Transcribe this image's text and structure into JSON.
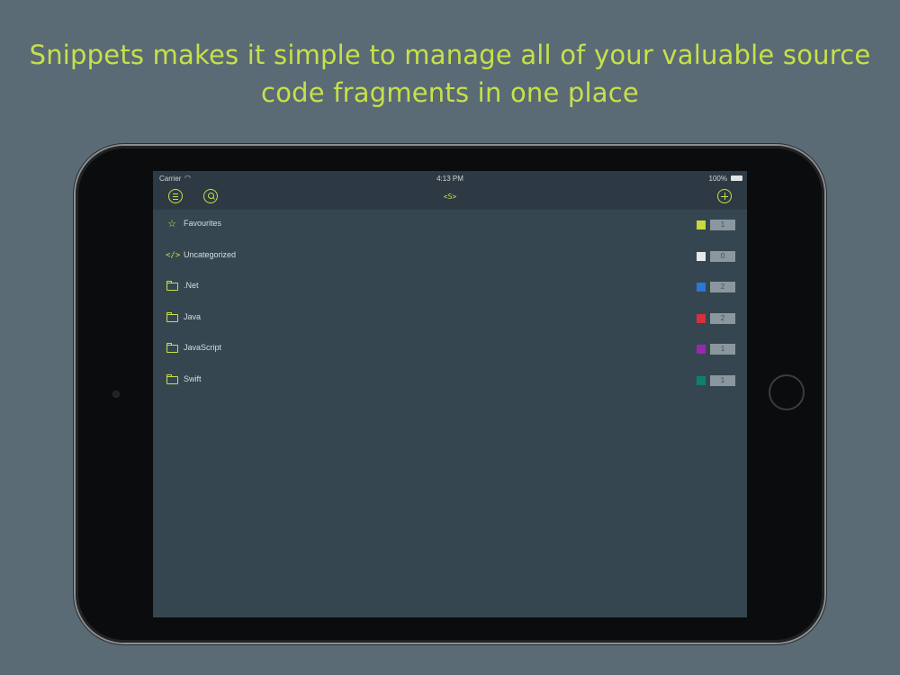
{
  "headline": {
    "line1": "Snippets makes it simple to manage all of your valuable source",
    "line2": "code fragments in one place"
  },
  "statusbar": {
    "carrier": "Carrier",
    "time": "4:13 PM",
    "battery": "100%"
  },
  "navbar": {
    "title": "<S>",
    "menu_icon": "menu-icon",
    "search_icon": "search-icon",
    "add_icon": "add-icon"
  },
  "colors": {
    "accent": "#c7e04a",
    "background": "#5a6b75",
    "screen": "#364650"
  },
  "categories": [
    {
      "label": "Favourites",
      "icon": "star-icon",
      "color": "#c7d83a",
      "count": "1"
    },
    {
      "label": "Uncategorized",
      "icon": "code-icon",
      "color": "#e6e8ea",
      "count": "0"
    },
    {
      "label": ".Net",
      "icon": "folder-icon",
      "color": "#2a78d6",
      "count": "2"
    },
    {
      "label": "Java",
      "icon": "folder-icon",
      "color": "#d4313a",
      "count": "2"
    },
    {
      "label": "JavaScript",
      "icon": "folder-icon",
      "color": "#9b27b0",
      "count": "1"
    },
    {
      "label": "Swift",
      "icon": "folder-icon",
      "color": "#0f7f6f",
      "count": "1"
    }
  ]
}
